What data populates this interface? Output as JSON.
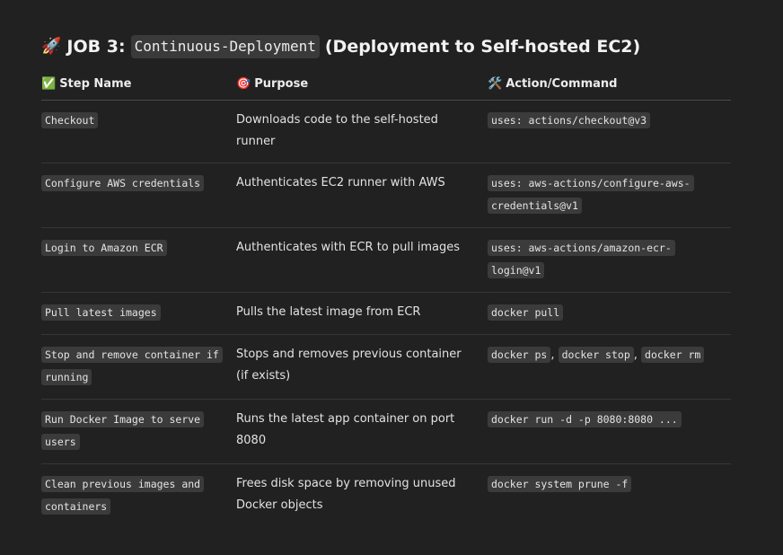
{
  "title": {
    "emoji": "🚀",
    "prefix": "JOB 3:",
    "code": "Continuous-Deployment",
    "suffix": "(Deployment to Self-hosted EC2)"
  },
  "headers": [
    {
      "emoji": "✅",
      "label": "Step Name"
    },
    {
      "emoji": "🎯",
      "label": "Purpose"
    },
    {
      "emoji": "🛠️",
      "label": "Action/Command"
    }
  ],
  "rows": [
    {
      "step": "Checkout",
      "purpose": "Downloads code to the self-hosted runner",
      "actions": [
        "uses: actions/checkout@v3"
      ]
    },
    {
      "step": "Configure AWS credentials",
      "purpose": "Authenticates EC2 runner with AWS",
      "actions": [
        "uses: aws-actions/configure-aws-credentials@v1"
      ]
    },
    {
      "step": "Login to Amazon ECR",
      "purpose": "Authenticates with ECR to pull images",
      "actions": [
        "uses: aws-actions/amazon-ecr-login@v1"
      ]
    },
    {
      "step": "Pull latest images",
      "purpose": "Pulls the latest image from ECR",
      "actions": [
        "docker pull"
      ]
    },
    {
      "step": "Stop and remove container if running",
      "purpose": "Stops and removes previous container (if exists)",
      "actions": [
        "docker ps",
        "docker stop",
        "docker rm"
      ]
    },
    {
      "step": "Run Docker Image to serve users",
      "purpose": "Runs the latest app container on port 8080",
      "actions": [
        "docker run -d -p 8080:8080 ..."
      ]
    },
    {
      "step": "Clean previous images and containers",
      "purpose": "Frees disk space by removing unused Docker objects",
      "actions": [
        "docker system prune -f"
      ]
    }
  ],
  "colors": {
    "background": "#212121",
    "code_bg": "#3b3b3b",
    "text": "#ececec"
  }
}
